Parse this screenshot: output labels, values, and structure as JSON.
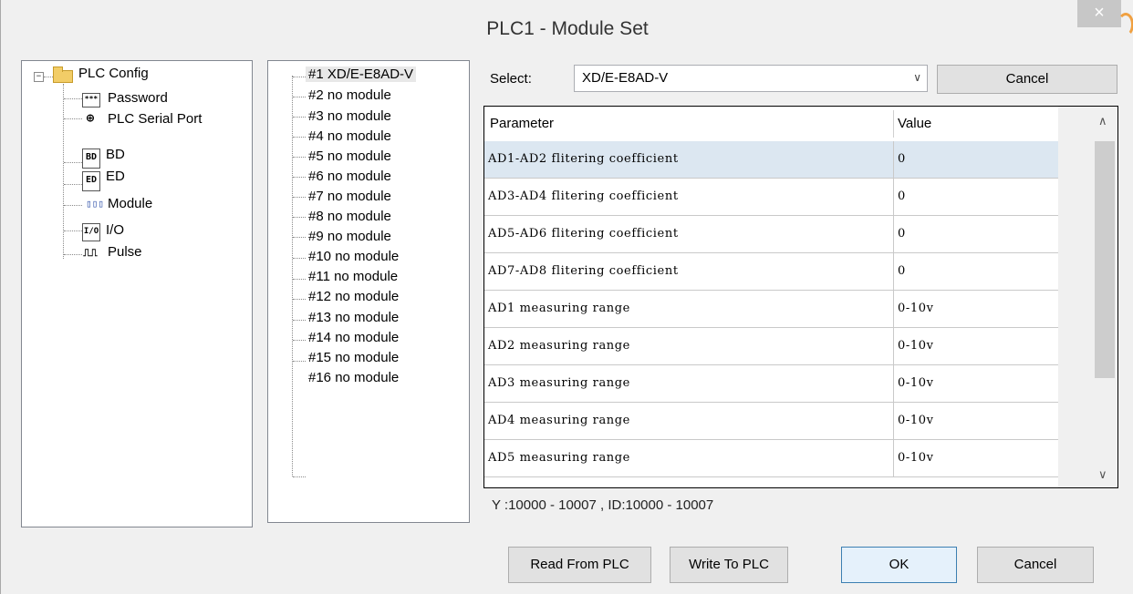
{
  "window": {
    "title": "PLC1 - Module  Set",
    "close_glyph": "×"
  },
  "config_tree": {
    "root": {
      "label": "PLC Config",
      "expander": "−"
    },
    "items": [
      {
        "label": "Password",
        "icon": "password-icon",
        "icon_text": "***"
      },
      {
        "label": "PLC Serial Port",
        "icon": "serial-port-icon",
        "icon_text": "⊕"
      },
      {
        "label": "BD",
        "icon": "bd-icon",
        "icon_text": "BD"
      },
      {
        "label": "ED",
        "icon": "ed-icon",
        "icon_text": "ED"
      },
      {
        "label": "Module",
        "icon": "module-icon",
        "icon_text": "▯▯▯"
      },
      {
        "label": "I/O",
        "icon": "io-icon",
        "icon_text": "I/O"
      },
      {
        "label": "Pulse",
        "icon": "pulse-icon",
        "icon_text": "⎍⎍"
      }
    ]
  },
  "module_list": [
    "#1 XD/E-E8AD-V",
    "#2 no module",
    "#3 no module",
    "#4 no module",
    "#5 no module",
    "#6 no module",
    "#7 no module",
    "#8 no module",
    "#9 no module",
    "#10 no module",
    "#11 no module",
    "#12 no module",
    "#13 no module",
    "#14 no module",
    "#15 no module",
    "#16 no module"
  ],
  "select": {
    "label": "Select:",
    "value": "XD/E-E8AD-V",
    "arrow": "∨",
    "cancel_label": "Cancel"
  },
  "grid": {
    "headers": {
      "parameter": "Parameter",
      "value": "Value"
    },
    "rows": [
      {
        "parameter": "AD1-AD2 flitering coefficient",
        "value": "0"
      },
      {
        "parameter": "AD3-AD4 flitering coefficient",
        "value": "0"
      },
      {
        "parameter": "AD5-AD6 flitering coefficient",
        "value": "0"
      },
      {
        "parameter": "AD7-AD8 flitering coefficient",
        "value": "0"
      },
      {
        "parameter": "AD1 measuring range",
        "value": "0-10v"
      },
      {
        "parameter": "AD2 measuring range",
        "value": "0-10v"
      },
      {
        "parameter": "AD3 measuring range",
        "value": "0-10v"
      },
      {
        "parameter": "AD4 measuring range",
        "value": "0-10v"
      },
      {
        "parameter": "AD5 measuring range",
        "value": "0-10v"
      }
    ],
    "scroll_up": "∧",
    "scroll_down": "∨"
  },
  "status": "Y :10000 - 10007 , ID:10000 - 10007",
  "buttons": {
    "read": "Read From PLC",
    "write": "Write To PLC",
    "ok": "OK",
    "cancel": "Cancel"
  }
}
